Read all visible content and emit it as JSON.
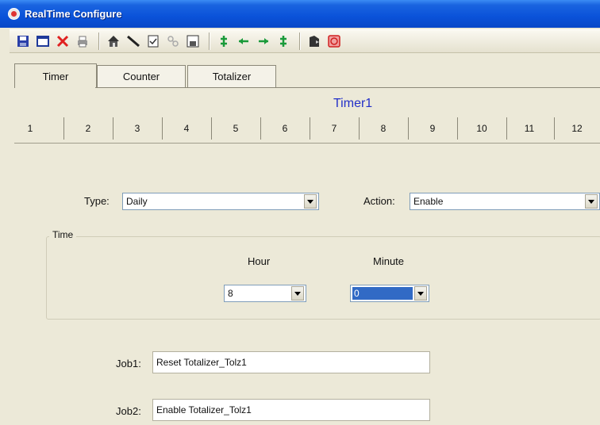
{
  "window": {
    "title": "RealTime Configure"
  },
  "toolbar": {
    "icons": [
      "save-icon",
      "window-icon",
      "delete-icon",
      "print-icon",
      "home-icon",
      "line-icon",
      "document-icon",
      "link-icon",
      "disk-icon",
      "arrows-up-down-icon",
      "arrow-left-icon",
      "arrow-right-icon",
      "arrows-up-down-icon",
      "run-icon",
      "stop-icon"
    ]
  },
  "tabs": {
    "timer": "Timer",
    "counter": "Counter",
    "totalizer": "Totalizer"
  },
  "timer_title": "Timer1",
  "number_tabs": [
    "1",
    "2",
    "3",
    "4",
    "5",
    "6",
    "7",
    "8",
    "9",
    "10",
    "11",
    "12"
  ],
  "type": {
    "label": "Type:",
    "value": "Daily"
  },
  "action": {
    "label": "Action:",
    "value": "Enable"
  },
  "time": {
    "group_label": "Time",
    "hour_label": "Hour",
    "minute_label": "Minute",
    "hour_value": "8",
    "minute_value": "0"
  },
  "jobs": {
    "job1_label": "Job1:",
    "job1_value": "Reset Totalizer_Tolz1",
    "job2_label": "Job2:",
    "job2_value": "Enable Totalizer_Tolz1"
  }
}
